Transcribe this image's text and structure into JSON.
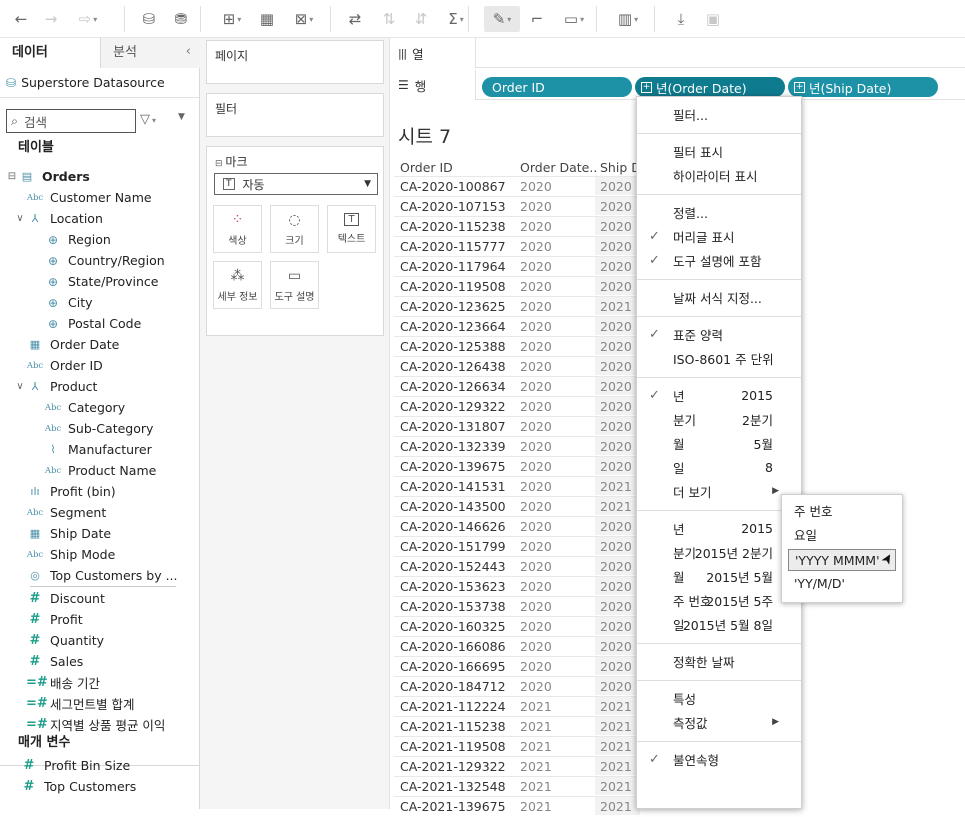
{
  "toolbar": {
    "icons": [
      "back-icon",
      "forward-icon",
      "redo-icon",
      "new-datasource-icon",
      "datasource-refresh-icon",
      "new-worksheet-icon",
      "duplicate-sheet-icon",
      "clear-sheet-icon",
      "swap-icon",
      "sort-ascending-icon",
      "sort-descending-icon",
      "totals-icon",
      "highlight-icon",
      "annotate-icon",
      "fit-icon",
      "show-me-icon",
      "download-icon",
      "presentation-icon"
    ]
  },
  "datapane": {
    "tab_data": "데이터",
    "tab_analysis": "분석",
    "datasource": "Superstore Datasource",
    "search_placeholder": "검색",
    "tables_header": "테이블",
    "parameters_header": "매개 변수",
    "fields": [
      {
        "label": "Orders",
        "icon": "table",
        "expander": "⊟",
        "level": 0,
        "bold": true
      },
      {
        "label": "Customer Name",
        "icon": "abc",
        "level": 1
      },
      {
        "label": "Location",
        "icon": "hier",
        "expander": "∨",
        "level": 1
      },
      {
        "label": "Region",
        "icon": "glob",
        "level": 2
      },
      {
        "label": "Country/Region",
        "icon": "glob",
        "level": 2
      },
      {
        "label": "State/Province",
        "icon": "glob",
        "level": 2
      },
      {
        "label": "City",
        "icon": "glob",
        "level": 2
      },
      {
        "label": "Postal Code",
        "icon": "glob",
        "level": 2
      },
      {
        "label": "Order Date",
        "icon": "cal",
        "level": 1
      },
      {
        "label": "Order ID",
        "icon": "abc",
        "level": 1
      },
      {
        "label": "Product",
        "icon": "hier",
        "expander": "∨",
        "level": 1
      },
      {
        "label": "Category",
        "icon": "abc",
        "level": 2
      },
      {
        "label": "Sub-Category",
        "icon": "abc",
        "level": 2
      },
      {
        "label": "Manufacturer",
        "icon": "clip",
        "level": 2
      },
      {
        "label": "Product Name",
        "icon": "abc",
        "level": 2
      },
      {
        "label": "Profit (bin)",
        "icon": "bin",
        "level": 1
      },
      {
        "label": "Segment",
        "icon": "abc",
        "level": 1
      },
      {
        "label": "Ship Date",
        "icon": "cal",
        "level": 1
      },
      {
        "label": "Ship Mode",
        "icon": "abc",
        "level": 1
      },
      {
        "label": "Top Customers by ...",
        "icon": "set",
        "level": 1
      },
      {
        "label": "Discount",
        "icon": "hash",
        "level": 1
      },
      {
        "label": "Profit",
        "icon": "hash",
        "level": 1
      },
      {
        "label": "Quantity",
        "icon": "hash",
        "level": 1
      },
      {
        "label": "Sales",
        "icon": "hash",
        "level": 1
      },
      {
        "label": "배송 기간",
        "icon": "calc",
        "level": 1
      },
      {
        "label": "세그먼트별 합계",
        "icon": "calc",
        "level": 1
      },
      {
        "label": "지역별 상품 평균 이익",
        "icon": "calc",
        "level": 1
      }
    ],
    "parameters": [
      {
        "label": "Profit Bin Size",
        "icon": "hash"
      },
      {
        "label": "Top Customers",
        "icon": "hash"
      }
    ]
  },
  "shelves": {
    "pages": "페이지",
    "filters": "필터",
    "marks": "마크",
    "mark_type": "자동",
    "mark_buttons": [
      {
        "label": "색상",
        "icon": "color"
      },
      {
        "label": "크기",
        "icon": "size"
      },
      {
        "label": "텍스트",
        "icon": "text"
      },
      {
        "label": "세부 정보",
        "icon": "detail"
      },
      {
        "label": "도구 설명",
        "icon": "tooltip"
      }
    ],
    "columns_label": "열",
    "rows_label": "행",
    "row_pills": [
      "Order ID",
      "년(Order Date)",
      "년(Ship Date)"
    ]
  },
  "sheet": {
    "title": "시트 7",
    "headers": [
      "Order ID",
      "Order Date..",
      "Ship D"
    ],
    "rows": [
      [
        "CA-2020-100867",
        "2020",
        "2020"
      ],
      [
        "CA-2020-107153",
        "2020",
        "2020"
      ],
      [
        "CA-2020-115238",
        "2020",
        "2020"
      ],
      [
        "CA-2020-115777",
        "2020",
        "2020"
      ],
      [
        "CA-2020-117964",
        "2020",
        "2020"
      ],
      [
        "CA-2020-119508",
        "2020",
        "2020"
      ],
      [
        "CA-2020-123625",
        "2020",
        "2021"
      ],
      [
        "CA-2020-123664",
        "2020",
        "2020"
      ],
      [
        "CA-2020-125388",
        "2020",
        "2020"
      ],
      [
        "CA-2020-126438",
        "2020",
        "2020"
      ],
      [
        "CA-2020-126634",
        "2020",
        "2020"
      ],
      [
        "CA-2020-129322",
        "2020",
        "2020"
      ],
      [
        "CA-2020-131807",
        "2020",
        "2020"
      ],
      [
        "CA-2020-132339",
        "2020",
        "2020"
      ],
      [
        "CA-2020-139675",
        "2020",
        "2020"
      ],
      [
        "CA-2020-141531",
        "2020",
        "2021"
      ],
      [
        "CA-2020-143500",
        "2020",
        "2021"
      ],
      [
        "CA-2020-146626",
        "2020",
        "2020"
      ],
      [
        "CA-2020-151799",
        "2020",
        "2020"
      ],
      [
        "CA-2020-152443",
        "2020",
        "2020"
      ],
      [
        "CA-2020-153623",
        "2020",
        "2020"
      ],
      [
        "CA-2020-153738",
        "2020",
        "2020"
      ],
      [
        "CA-2020-160325",
        "2020",
        "2020"
      ],
      [
        "CA-2020-166086",
        "2020",
        "2020"
      ],
      [
        "CA-2020-166695",
        "2020",
        "2020"
      ],
      [
        "CA-2020-184712",
        "2020",
        "2020"
      ],
      [
        "CA-2021-112224",
        "2021",
        "2021"
      ],
      [
        "CA-2021-115238",
        "2021",
        "2021"
      ],
      [
        "CA-2021-119508",
        "2021",
        "2021"
      ],
      [
        "CA-2021-129322",
        "2021",
        "2021"
      ],
      [
        "CA-2021-132548",
        "2021",
        "2021"
      ],
      [
        "CA-2021-139675",
        "2021",
        "2021"
      ]
    ]
  },
  "menu": {
    "items": [
      {
        "label": "필터..."
      },
      {
        "sep": true
      },
      {
        "label": "필터 표시"
      },
      {
        "label": "하이라이터 표시"
      },
      {
        "sep": true
      },
      {
        "label": "정렬..."
      },
      {
        "label": "머리글 표시",
        "check": true
      },
      {
        "label": "도구 설명에 포함",
        "check": true
      },
      {
        "sep": true
      },
      {
        "label": "날짜 서식 지정..."
      },
      {
        "sep": true
      },
      {
        "label": "표준 양력",
        "check": true
      },
      {
        "label": "ISO-8601 주 단위"
      },
      {
        "sep": true
      },
      {
        "label": "년",
        "value": "2015",
        "check": true
      },
      {
        "label": "분기",
        "value": "2분기"
      },
      {
        "label": "월",
        "value": "5월"
      },
      {
        "label": "일",
        "value": "8"
      },
      {
        "label": "더 보기",
        "submenu": true
      },
      {
        "sep": true
      },
      {
        "label": "년",
        "value": "2015"
      },
      {
        "label": "분기",
        "value": "2015년 2분기"
      },
      {
        "label": "월",
        "value": "2015년 5월"
      },
      {
        "label": "주 번호",
        "value": "2015년 5주"
      },
      {
        "label": "일",
        "value": "2015년 5월 8일"
      },
      {
        "sep": true
      },
      {
        "label": "정확한 날짜"
      },
      {
        "sep": true
      },
      {
        "label": "특성"
      },
      {
        "label": "측정값",
        "submenu": true
      },
      {
        "sep": true
      },
      {
        "label": "불연속형",
        "check": true
      }
    ]
  },
  "submenu": {
    "items": [
      "주 번호",
      "요일",
      "'YYYY MMMM'",
      "'YY/M/D'"
    ],
    "highlighted": 2
  }
}
